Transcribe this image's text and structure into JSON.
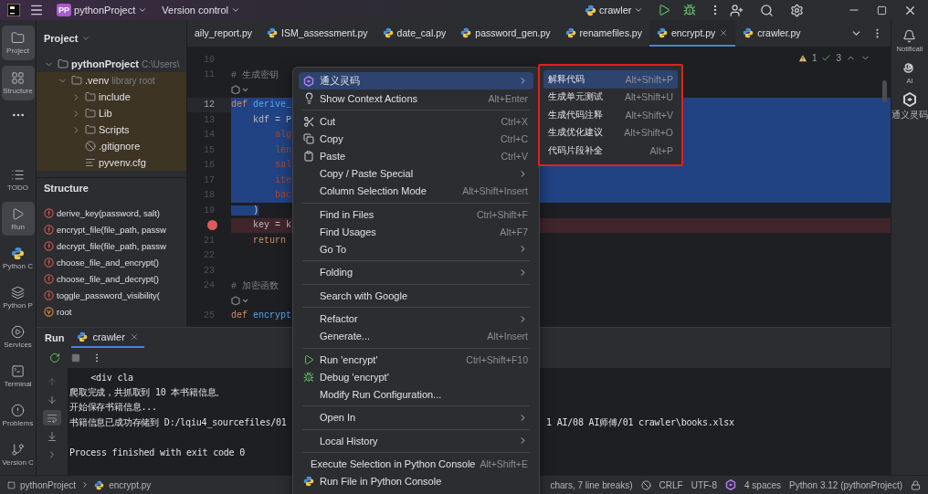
{
  "title_bar": {
    "project_badge": "PP",
    "project": "pythonProject",
    "vcs": "Version control",
    "run_config": "crawler"
  },
  "tool_strip_left": {
    "top": [
      {
        "label": "Project",
        "selected": true
      },
      {
        "label": "Structure",
        "selected": true
      }
    ],
    "bottom": [
      {
        "label": "TODO",
        "selected": false
      },
      {
        "label": "Run",
        "selected": true
      },
      {
        "label": "Python C",
        "selected": false
      },
      {
        "label": "Python P",
        "selected": false
      },
      {
        "label": "Services",
        "selected": false
      },
      {
        "label": "Terminal",
        "selected": false
      },
      {
        "label": "Problems",
        "selected": false
      },
      {
        "label": "Version C",
        "selected": false
      }
    ]
  },
  "project_panel": {
    "title": "Project",
    "tree": [
      {
        "name": "pythonProject",
        "hint": "C:\\Users\\",
        "kind": "folder",
        "expanded": true,
        "children": [
          {
            "name": ".venv",
            "hint": "library root",
            "kind": "folder",
            "expanded": true,
            "excluded": true,
            "children": [
              {
                "name": "include",
                "kind": "folder",
                "expanded": false
              },
              {
                "name": "Lib",
                "kind": "folder",
                "expanded": false
              },
              {
                "name": "Scripts",
                "kind": "folder",
                "expanded": false
              },
              {
                "name": ".gitignore",
                "kind": "ignore"
              },
              {
                "name": "pyvenv.cfg",
                "kind": "text"
              }
            ]
          }
        ]
      }
    ]
  },
  "structure_panel": {
    "title": "Structure",
    "items": [
      {
        "label": "derive_key(password, salt)",
        "kind": "function"
      },
      {
        "label": "encrypt_file(file_path, passw",
        "kind": "function"
      },
      {
        "label": "decrypt_file(file_path, passw",
        "kind": "function"
      },
      {
        "label": "choose_file_and_encrypt()",
        "kind": "function"
      },
      {
        "label": "choose_file_and_decrypt()",
        "kind": "function"
      },
      {
        "label": "toggle_password_visibility(",
        "kind": "function"
      },
      {
        "label": "root",
        "kind": "variable"
      }
    ]
  },
  "editor": {
    "tabs": [
      {
        "label": "aily_report.py",
        "kind": "partial",
        "selected": false
      },
      {
        "label": "ISM_assessment.py",
        "kind": "python",
        "selected": false
      },
      {
        "label": "date_cal.py",
        "kind": "python",
        "selected": false
      },
      {
        "label": "password_gen.py",
        "kind": "python",
        "selected": false
      },
      {
        "label": "renamefiles.py",
        "kind": "python",
        "selected": false
      },
      {
        "label": "encrypt.py",
        "kind": "python",
        "selected": true
      },
      {
        "label": "crawler.py",
        "kind": "python",
        "selected": false
      }
    ],
    "inspections": {
      "warnings": "1",
      "checks": "3"
    },
    "lines": [
      {
        "kind": "code",
        "number": "10",
        "selected": false
      },
      {
        "kind": "code",
        "number": "11",
        "selected": false,
        "tokens": [
          {
            "text": "# 生成密钥",
            "kind": "comment"
          }
        ]
      },
      {
        "kind": "hint"
      },
      {
        "kind": "code",
        "number": "12",
        "current": true,
        "selected": true,
        "tokens": [
          {
            "text": "def ",
            "kind": "keyword"
          },
          {
            "text": "derive_",
            "kind": "function"
          }
        ]
      },
      {
        "kind": "code",
        "number": "13",
        "selected": true,
        "tokens": [
          {
            "text": "    kdf = P",
            "kind": "plain"
          }
        ]
      },
      {
        "kind": "code",
        "number": "14",
        "selected": true,
        "tokens": [
          {
            "text": "        alg",
            "kind": "param"
          }
        ]
      },
      {
        "kind": "code",
        "number": "15",
        "selected": true,
        "tokens": [
          {
            "text": "        len",
            "kind": "param"
          }
        ]
      },
      {
        "kind": "code",
        "number": "16",
        "selected": true,
        "tokens": [
          {
            "text": "        sal",
            "kind": "param"
          }
        ]
      },
      {
        "kind": "code",
        "number": "17",
        "selected": true,
        "tokens": [
          {
            "text": "        ite",
            "kind": "param"
          }
        ]
      },
      {
        "kind": "code",
        "number": "18",
        "selected": true,
        "tokens": [
          {
            "text": "        bac",
            "kind": "param"
          }
        ]
      },
      {
        "kind": "code",
        "number": "19",
        "selected": false,
        "tokens": [
          {
            "text": "    )",
            "kind": "plain",
            "selected": true
          }
        ]
      },
      {
        "kind": "code",
        "breakpoint": true,
        "selected": false,
        "tokens": [
          {
            "text": "    key = k",
            "kind": "plain"
          }
        ]
      },
      {
        "kind": "code",
        "number": "21",
        "selected": false,
        "tokens": [
          {
            "text": "    return",
            "kind": "keyword"
          }
        ]
      },
      {
        "kind": "code",
        "number": "22",
        "selected": false
      },
      {
        "kind": "code",
        "number": "23",
        "selected": false
      },
      {
        "kind": "code",
        "number": "24",
        "selected": false,
        "tokens": [
          {
            "text": "# 加密函数",
            "kind": "comment"
          }
        ]
      },
      {
        "kind": "hint"
      },
      {
        "kind": "code",
        "number": "25",
        "selected": false,
        "tokens": [
          {
            "text": "def ",
            "kind": "keyword"
          },
          {
            "text": "encrypt",
            "kind": "function"
          }
        ]
      }
    ]
  },
  "context_menu": {
    "groups": [
      [
        {
          "kind": "ai",
          "label": "通义灵码",
          "submenu": true,
          "selected": true
        },
        {
          "kind": "bulb",
          "label": "Show Context Actions",
          "shortcut": "Alt+Enter",
          "selected": false
        }
      ],
      [
        {
          "kind": "cut",
          "label": "Cut",
          "shortcut": "Ctrl+X",
          "selected": false
        },
        {
          "kind": "copy",
          "label": "Copy",
          "shortcut": "Ctrl+C",
          "selected": false
        },
        {
          "kind": "paste",
          "label": "Paste",
          "shortcut": "Ctrl+V",
          "selected": false
        },
        {
          "kind": "plain",
          "label": "Copy / Paste Special",
          "submenu": true,
          "selected": false
        },
        {
          "kind": "plain",
          "label": "Column Selection Mode",
          "shortcut": "Alt+Shift+Insert",
          "selected": false
        }
      ],
      [
        {
          "kind": "plain",
          "label": "Find in Files",
          "shortcut": "Ctrl+Shift+F",
          "selected": false
        },
        {
          "kind": "plain",
          "label": "Find Usages",
          "shortcut": "Alt+F7",
          "selected": false
        },
        {
          "kind": "plain",
          "label": "Go To",
          "submenu": true,
          "selected": false
        }
      ],
      [
        {
          "kind": "plain",
          "label": "Folding",
          "submenu": true,
          "selected": false
        }
      ],
      [
        {
          "kind": "plain",
          "label": "Search with Google",
          "selected": false
        }
      ],
      [
        {
          "kind": "plain",
          "label": "Refactor",
          "submenu": true,
          "selected": false
        },
        {
          "kind": "plain",
          "label": "Generate...",
          "shortcut": "Alt+Insert",
          "selected": false
        }
      ],
      [
        {
          "kind": "run",
          "label": "Run 'encrypt'",
          "shortcut": "Ctrl+Shift+F10",
          "selected": false
        },
        {
          "kind": "debug",
          "label": "Debug 'encrypt'",
          "selected": false
        },
        {
          "kind": "plain",
          "label": "Modify Run Configuration...",
          "selected": false
        }
      ],
      [
        {
          "kind": "plain",
          "label": "Open In",
          "submenu": true,
          "selected": false
        }
      ],
      [
        {
          "kind": "plain",
          "label": "Local History",
          "submenu": true,
          "selected": false
        }
      ],
      [
        {
          "kind": "plain",
          "label": "Execute Selection in Python Console",
          "shortcut": "Alt+Shift+E",
          "selected": false
        },
        {
          "kind": "python",
          "label": "Run File in Python Console",
          "selected": false
        }
      ]
    ]
  },
  "submenu": {
    "highlighted": true,
    "items": [
      {
        "label": "解释代码",
        "shortcut": "Alt+Shift+P",
        "selected": true
      },
      {
        "label": "生成单元测试",
        "shortcut": "Alt+Shift+U",
        "selected": false
      },
      {
        "label": "生成代码注释",
        "shortcut": "Alt+Shift+V",
        "selected": false
      },
      {
        "label": "生成优化建议",
        "shortcut": "Alt+Shift+O",
        "selected": false
      },
      {
        "label": "代码片段补全",
        "shortcut": "Alt+P",
        "selected": false
      }
    ]
  },
  "run_panel": {
    "title": "Run",
    "tabs": [
      {
        "label": "crawler",
        "selected": true
      }
    ],
    "soft_wrap": true,
    "output": [
      {
        "kind": "text",
        "text": "    <div cla"
      },
      {
        "kind": "text",
        "text": "爬取完成，共抓取到 10 本书籍信息。"
      },
      {
        "kind": "text",
        "text": "开始保存书籍信息..."
      },
      {
        "kind": "text",
        "text": "书籍信息已成功存储到 D:/lqiu4_sourcefiles/01",
        "tail": "1 AI/08 AI师傅/01 crawler\\books.xlsx"
      },
      {
        "kind": "blank"
      },
      {
        "kind": "text",
        "text": "Process finished with exit code 0"
      }
    ]
  },
  "tool_strip_right": [
    {
      "label": "Notificati"
    },
    {
      "label": "AI"
    },
    {
      "label": "通义灵码"
    }
  ],
  "status_bar": {
    "breadcrumbs": [
      "pythonProject",
      "encrypt.py"
    ],
    "selection_info": "chars, 7 line breaks)",
    "line_separator": "CRLF",
    "encoding": "UTF-8",
    "indent": "4 spaces",
    "interpreter": "Python 3.12 (pythonProject)"
  }
}
